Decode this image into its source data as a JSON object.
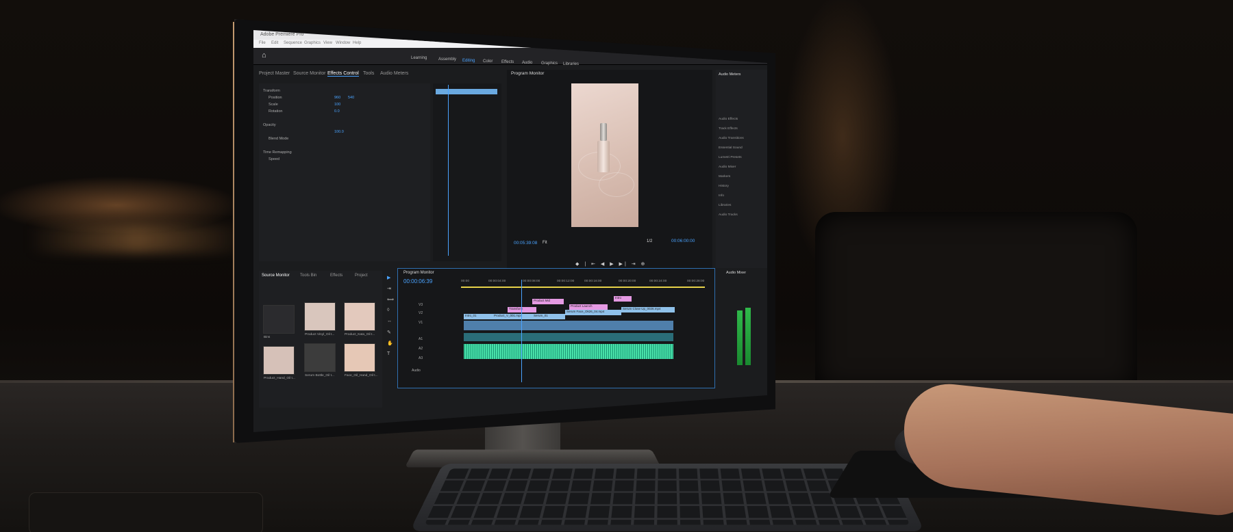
{
  "window": {
    "title": "Adobe Premiere Pro",
    "menu": [
      "File",
      "Edit",
      "Sequence",
      "Graphics",
      "View",
      "Window",
      "Help"
    ]
  },
  "workspaces": [
    "Learning",
    "Assembly",
    "Editing",
    "Color",
    "Effects",
    "Audio",
    "Graphics",
    "Libraries"
  ],
  "active_workspace": "Editing",
  "panels": {
    "top_tabs": [
      "Project Master",
      "Source Monitor",
      "Effects Control",
      "Tools",
      "Audio Meters"
    ],
    "active_tab": "Effects Control",
    "program_monitor_title": "Program Monitor",
    "audio_meters_title": "Audio Meters",
    "audio_mixer_title": "Audio Mixer"
  },
  "effects_control": {
    "rows": [
      "Transform",
      "Position",
      "Scale",
      "Rotation",
      "Opacity",
      "Blend Mode",
      "Time Remapping",
      "Speed"
    ],
    "values": [
      "960",
      "540",
      "100",
      "0.0",
      "100.0"
    ]
  },
  "program_monitor": {
    "timecode": "00:05:39:08",
    "fit": "Fit",
    "fraction": "1/2",
    "duration": "00:06:00:00"
  },
  "audio_list": [
    "Audio Effects",
    "Track Effects",
    "Audio Transitions",
    "Essential Sound",
    "Lumetri Presets",
    "Audio Mixer",
    "Markers",
    "History",
    "Info",
    "Libraries",
    "Audio Tracks"
  ],
  "bin": {
    "tabs": [
      "Source Monitor",
      "Tools Bin",
      "Effects",
      "Project"
    ],
    "active_tab": "Source Monitor",
    "items": [
      "Bins",
      "Product Vinyl_Oil t...",
      "Product_Kata_Oil t...",
      "Product_Hand_Oil t...",
      "Serum Bottle_Oil t...",
      "Face_Oil_Hand_Oil t..."
    ]
  },
  "timeline": {
    "title": "Program Monitor",
    "timecode": "00:00:06:39",
    "ruler": [
      "00:00",
      "00:00:04:00",
      "00:00:08:00",
      "00:00:12:00",
      "00:00:16:00",
      "00:00:20:00",
      "00:00:24:00",
      "00:00:28:00"
    ],
    "tracks": [
      "V3",
      "V2",
      "V1",
      "A1",
      "A2",
      "A3"
    ],
    "audio_label": "Audio",
    "clips_pink": [
      "Transform",
      "Product Mid",
      "Product Launch",
      "Intro"
    ],
    "clips_blue": [
      "Intro_01",
      "Product_V_001.mp4",
      "Serum_01",
      "Serum Face_Ok26_04.mp4",
      "Serum Close Up_0026.mp4"
    ]
  },
  "colors": {
    "accent": "#4aa3ff",
    "audio_waveform": "#3fd9a0",
    "label_pink": "#e59ae3",
    "label_blue": "#8fc1ea"
  }
}
